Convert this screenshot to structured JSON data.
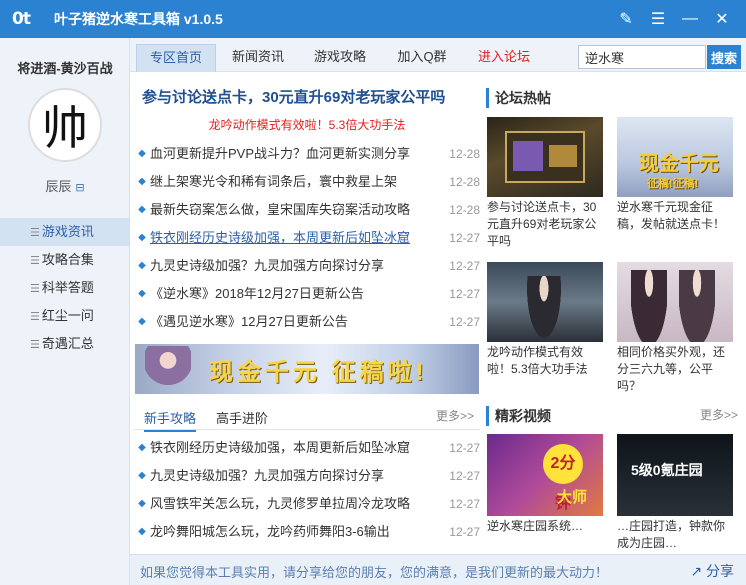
{
  "app": {
    "logo_text": "0t",
    "title": "叶子猪逆水寒工具箱 v1.0.5"
  },
  "window_controls": {
    "pin": "✎",
    "menu": "☰",
    "minimize": "—",
    "close": "✕"
  },
  "sidebar": {
    "server_name": "将进酒-黄沙百战",
    "avatar_char": "帅",
    "user_name": "辰辰",
    "items": [
      {
        "label": "游戏资讯",
        "active": true
      },
      {
        "label": "攻略合集"
      },
      {
        "label": "科举答题"
      },
      {
        "label": "红尘一问"
      },
      {
        "label": "奇遇汇总"
      }
    ]
  },
  "tabs": [
    {
      "label": "专区首页",
      "active": true
    },
    {
      "label": "新闻资讯"
    },
    {
      "label": "游戏攻略"
    },
    {
      "label": "加入Q群"
    },
    {
      "label": "进入论坛",
      "highlight": true
    }
  ],
  "search": {
    "value": "逆水寒",
    "button": "搜索"
  },
  "main": {
    "headline": "参与讨论送点卡，30元直升69对老玩家公平吗",
    "subline": "龙吟动作模式有效啦！5.3倍大功手法",
    "news": [
      {
        "title": "血河更新提升PVP战斗力？血河更新实测分享",
        "date": "12-28"
      },
      {
        "title": "继上架寒光令和稀有词条后，寰中救星上架",
        "date": "12-28"
      },
      {
        "title": "最新失窃案怎么做，皇宋国库失窃案活动攻略",
        "date": "12-28"
      },
      {
        "title": "铁衣刚经历史诗级加强，本周更新后如坠冰窟",
        "date": "12-27",
        "link": true
      },
      {
        "title": "九灵史诗级加强？九灵加强方向探讨分享",
        "date": "12-27"
      },
      {
        "title": "《逆水寒》2018年12月27日更新公告",
        "date": "12-27"
      },
      {
        "title": "《遇见逆水寒》12月27日更新公告",
        "date": "12-27"
      }
    ],
    "banner_text": "现金千元 征稿啦!",
    "sub_tabs": [
      {
        "label": "新手攻略",
        "active": true
      },
      {
        "label": "高手进阶"
      }
    ],
    "more_label": "更多>>",
    "news2": [
      {
        "title": "铁衣刚经历史诗级加强，本周更新后如坠冰窟",
        "date": "12-27"
      },
      {
        "title": "九灵史诗级加强？九灵加强方向探讨分享",
        "date": "12-27"
      },
      {
        "title": "风雪铁牢关怎么玩，九灵修罗单拉周冷龙攻略",
        "date": "12-27"
      },
      {
        "title": "龙吟舞阳城怎么玩，龙吟药师舞阳3-6输出",
        "date": "12-27"
      }
    ]
  },
  "right": {
    "forum_title": "论坛热帖",
    "forum_posts": [
      {
        "caption": "参与讨论送点卡，30元直升69对老玩家公平吗"
      },
      {
        "caption": "逆水寒千元现金征稿，发帖就送点卡！",
        "thumb_text": "现金千元",
        "thumb_sub": "征稿!征稿!"
      },
      {
        "caption": "龙吟动作模式有效啦！5.3倍大功手法"
      },
      {
        "caption": "相同价格买外观，还分三六九等，公平吗？"
      }
    ],
    "video_title": "精彩视频",
    "more_label": "更多>>",
    "videos": [
      {
        "caption": "逆水寒庄园系统…",
        "thumb_text": "2分钟",
        "thumb_sub": "大师"
      },
      {
        "caption": "…庄园打造，钟款你成为庄园…",
        "thumb_text": "5级0氪庄园"
      }
    ]
  },
  "bottom": {
    "message": "如果您觉得本工具实用，请分享给您的朋友，您的满意，是我们更新的最大动力！",
    "share": "分享"
  },
  "colors": {
    "accent": "#2b82d0",
    "red": "#e02020",
    "link": "#2b5fa8"
  }
}
